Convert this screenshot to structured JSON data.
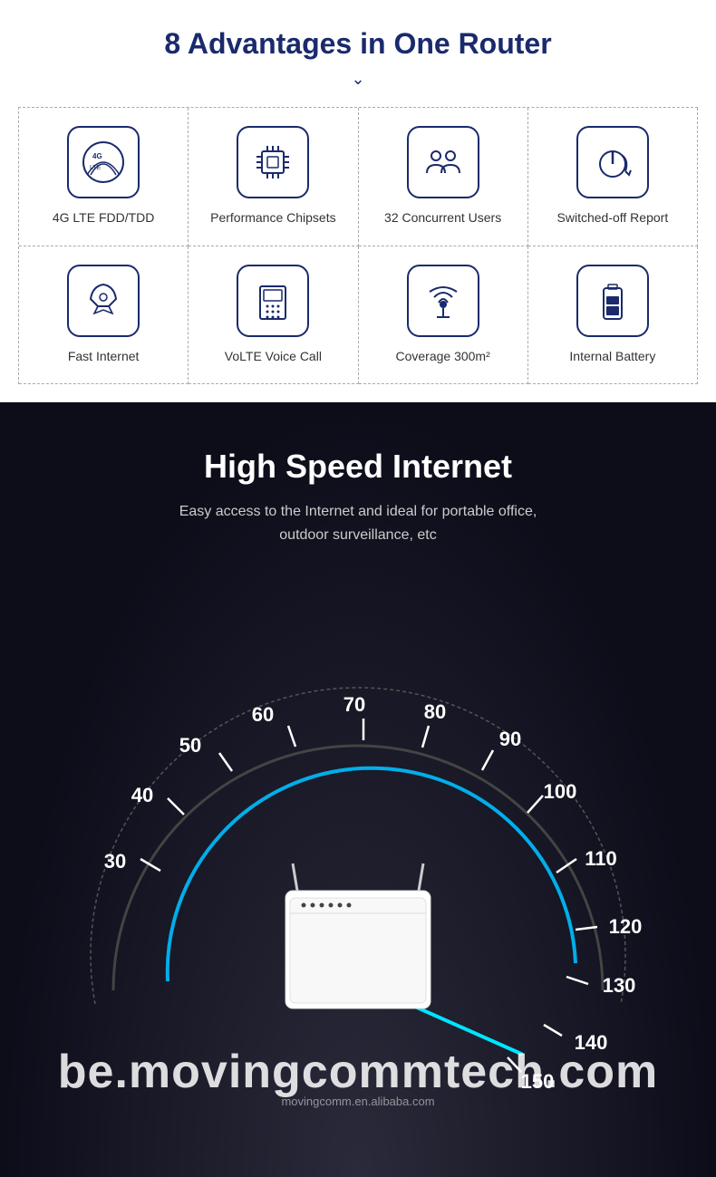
{
  "advantages": {
    "title": "8 Advantages in One Router",
    "items": [
      {
        "id": "4g-lte",
        "label": "4G LTE FDD/TDD",
        "icon": "4g"
      },
      {
        "id": "chipset",
        "label": "Performance Chipsets",
        "icon": "chip"
      },
      {
        "id": "users",
        "label": "32 Concurrent Users",
        "icon": "users"
      },
      {
        "id": "switched-off",
        "label": "Switched-off Report",
        "icon": "power"
      },
      {
        "id": "fast-internet",
        "label": "Fast Internet",
        "icon": "rocket"
      },
      {
        "id": "volte",
        "label": "VoLTE Voice Call",
        "icon": "phone"
      },
      {
        "id": "coverage",
        "label": "Coverage 300m²",
        "icon": "coverage"
      },
      {
        "id": "battery",
        "label": "Internal Battery",
        "icon": "battery"
      }
    ]
  },
  "speed_section": {
    "title": "High Speed Internet",
    "subtitle_line1": "Easy access to the Internet and ideal for portable office,",
    "subtitle_line2": "outdoor surveillance, etc",
    "speedometer_labels": [
      "30",
      "40",
      "50",
      "60",
      "70",
      "80",
      "90",
      "100",
      "110",
      "120",
      "130",
      "140",
      "150"
    ],
    "needle_value": 150,
    "watermark": "be.movingcommtech.com",
    "watermark_small": "movingcomm.en.alibaba.com"
  }
}
